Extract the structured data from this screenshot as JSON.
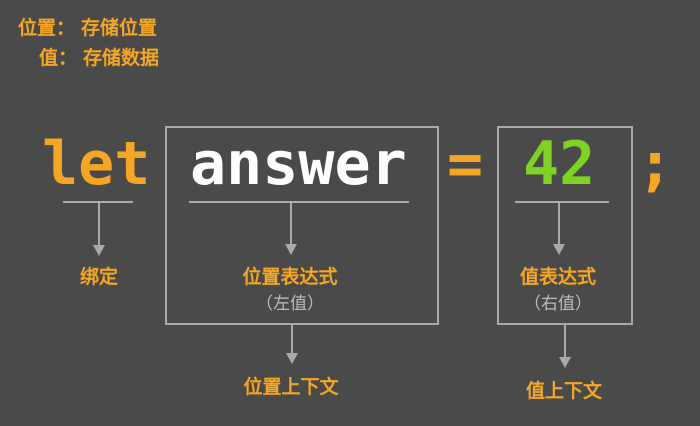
{
  "legend": {
    "location_key": "位置：",
    "location_val": "存储位置",
    "value_key": "值：",
    "value_val": "存储数据"
  },
  "code": {
    "keyword": "let",
    "identifier": "answer",
    "equals": "=",
    "literal": "42",
    "semicolon": ";"
  },
  "labels": {
    "binding": "绑定",
    "place_expression": "位置表达式",
    "lvalue": "（左值）",
    "value_expression": "值表达式",
    "rvalue": "（右值）",
    "place_context": "位置上下文",
    "value_context": "值上下文"
  },
  "colors": {
    "background": "#4a4a4a",
    "accent_orange": "#f5a623",
    "literal_green": "#7ed321",
    "identifier_white": "#ffffff",
    "lines_gray": "#a9a9a9"
  }
}
